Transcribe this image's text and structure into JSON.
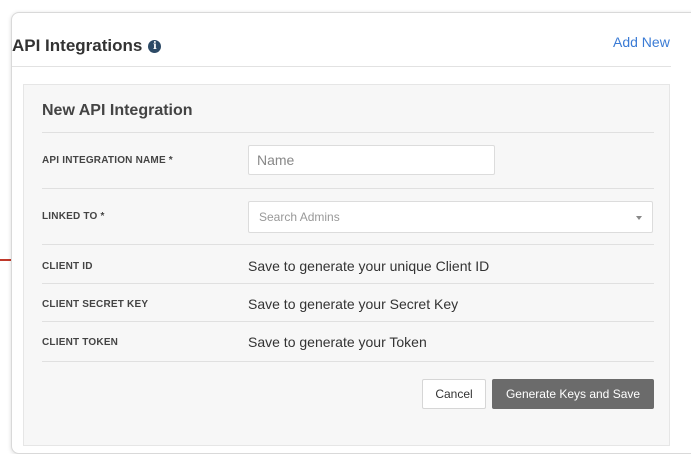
{
  "header": {
    "title": "API Integrations",
    "add_new": "Add New"
  },
  "panel": {
    "title": "New API Integration",
    "fields": {
      "name": {
        "label": "API INTEGRATION NAME *",
        "placeholder": "Name"
      },
      "linked_to": {
        "label": "LINKED TO *",
        "placeholder": "Search Admins"
      },
      "client_id": {
        "label": "CLIENT ID",
        "value": "Save to generate your unique Client ID"
      },
      "client_secret": {
        "label": "CLIENT SECRET KEY",
        "value": "Save to generate your Secret Key"
      },
      "client_token": {
        "label": "CLIENT TOKEN",
        "value": "Save to generate your Token"
      }
    },
    "buttons": {
      "cancel": "Cancel",
      "save": "Generate Keys and Save"
    }
  },
  "icons": {
    "info": "info-icon",
    "caret": "chevron-down-icon"
  },
  "colors": {
    "link": "#3a7bd5",
    "info_icon": "#2d4a66",
    "save_button": "#6b6b6b",
    "accent_line": "#c0392b"
  }
}
